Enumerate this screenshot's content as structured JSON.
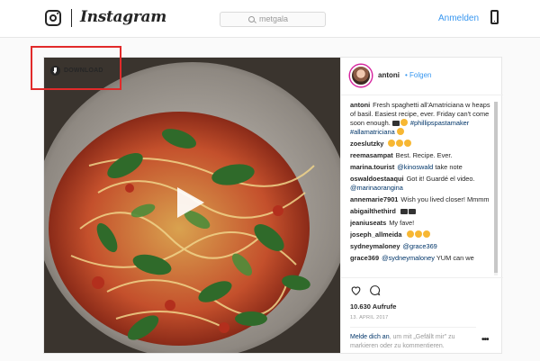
{
  "nav": {
    "brand": "Instagram",
    "search_value": "metgala",
    "login_label": "Anmelden",
    "logo_icon": "instagram-glyph-icon",
    "mobile_icon": "mobile-phone-icon"
  },
  "post": {
    "download_label": "DOWNLOAD",
    "author": "antoni",
    "follow_label": "Folgen",
    "caption": {
      "user": "antoni",
      "text": "Fresh spaghetti all'Amatriciana w heaps of basil. Easiest recipe, ever. Friday can't come soon enough.",
      "hashtags": "#phillipspastamaker #allamatriciana"
    },
    "comments": [
      {
        "user": "zoeslutzky",
        "text": ""
      },
      {
        "user": "reemasampat",
        "text": "Best. Recipe. Ever."
      },
      {
        "user": "marina.tourist",
        "mention": "@kinoswald",
        "text": "take note"
      },
      {
        "user": "oswaldoestaaqui",
        "text": "Got it! Guardé el video.",
        "mention": "@marinaorangina"
      },
      {
        "user": "annemarie7901",
        "text": "Wish you lived closer! Mmmm"
      },
      {
        "user": "abigailthethird",
        "text": ""
      },
      {
        "user": "jeaniuseats",
        "text": "My fave!"
      },
      {
        "user": "joseph_allmeida",
        "text": ""
      },
      {
        "user": "sydneymaloney",
        "mention": "@grace369"
      },
      {
        "user": "grace369",
        "mention": "@sydneymaloney",
        "text": "YUM can we"
      }
    ],
    "views": "10.630 Aufrufe",
    "date": "13. APRIL 2017",
    "login_prompt": {
      "link": "Melde dich an",
      "text": ", um mit „Gefällt mir\" zu markieren oder zu kommentieren."
    },
    "more_label": "•••",
    "colors": {
      "accent": "#3897f0",
      "highlight": "#e12a2a"
    }
  }
}
